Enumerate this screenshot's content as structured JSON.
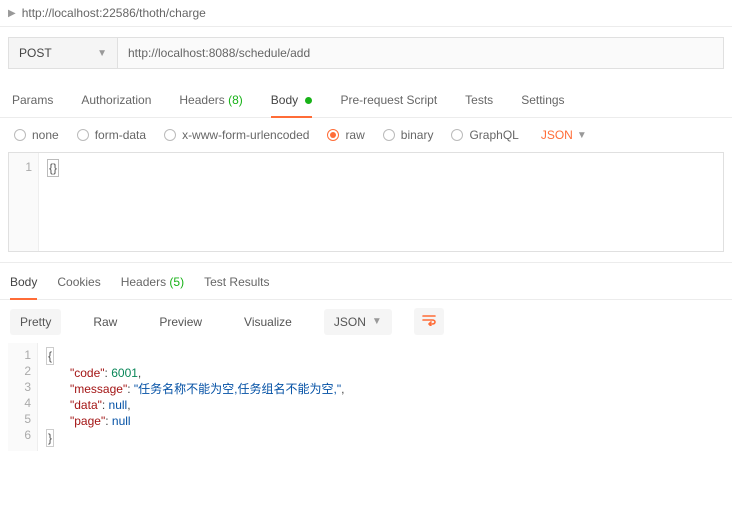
{
  "collapsed_request": {
    "url": "http://localhost:22586/thoth/charge"
  },
  "request": {
    "method": "POST",
    "url": "http://localhost:8088/schedule/add"
  },
  "tabs": {
    "params": "Params",
    "auth": "Authorization",
    "headers_label": "Headers",
    "headers_count": "(8)",
    "body": "Body",
    "prerequest": "Pre-request Script",
    "tests": "Tests",
    "settings": "Settings"
  },
  "body_options": {
    "none": "none",
    "formdata": "form-data",
    "urlencoded": "x-www-form-urlencoded",
    "raw": "raw",
    "binary": "binary",
    "graphql": "GraphQL",
    "content_type": "JSON"
  },
  "request_body": {
    "line1": "{}"
  },
  "response_tabs": {
    "body": "Body",
    "cookies": "Cookies",
    "headers_label": "Headers",
    "headers_count": "(5)",
    "test_results": "Test Results"
  },
  "response_toolbar": {
    "pretty": "Pretty",
    "raw": "Raw",
    "preview": "Preview",
    "visualize": "Visualize",
    "type": "JSON"
  },
  "response_body": {
    "code_key": "\"code\"",
    "code_val": "6001",
    "message_key": "\"message\"",
    "message_val": "\"任务名称不能为空,任务组名不能为空,\"",
    "data_key": "\"data\"",
    "data_val": "null",
    "page_key": "\"page\"",
    "page_val": "null"
  }
}
